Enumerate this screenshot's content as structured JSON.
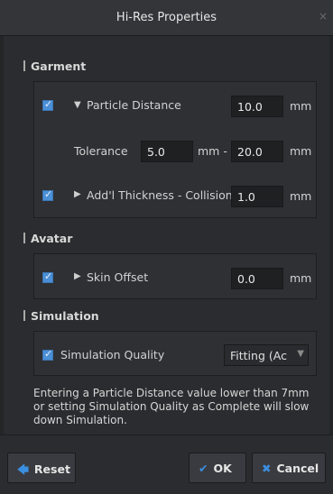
{
  "window": {
    "title": "Hi-Res Properties",
    "close": "×"
  },
  "garment": {
    "title": "Garment",
    "particle_distance": {
      "label": "Particle Distance",
      "value": "10.0",
      "unit": "mm",
      "checked": true
    },
    "tolerance": {
      "label": "Tolerance",
      "min": "5.0",
      "mid_unit": "mm -",
      "max": "20.0",
      "unit": "mm"
    },
    "addl_thickness": {
      "label": "Add'l Thickness - Collision",
      "value": "1.0",
      "unit": "mm",
      "checked": true
    }
  },
  "avatar": {
    "title": "Avatar",
    "skin_offset": {
      "label": "Skin Offset",
      "value": "0.0",
      "unit": "mm",
      "checked": true
    }
  },
  "simulation": {
    "title": "Simulation",
    "quality": {
      "label": "Simulation Quality",
      "value": "Fitting (Ac",
      "checked": true
    }
  },
  "info_text": "Entering a Particle Distance value lower than 7mm or setting Simulation Quality as Complete will slow down Simulation.",
  "buttons": {
    "reset": "Reset",
    "ok": "OK",
    "cancel": "Cancel"
  }
}
